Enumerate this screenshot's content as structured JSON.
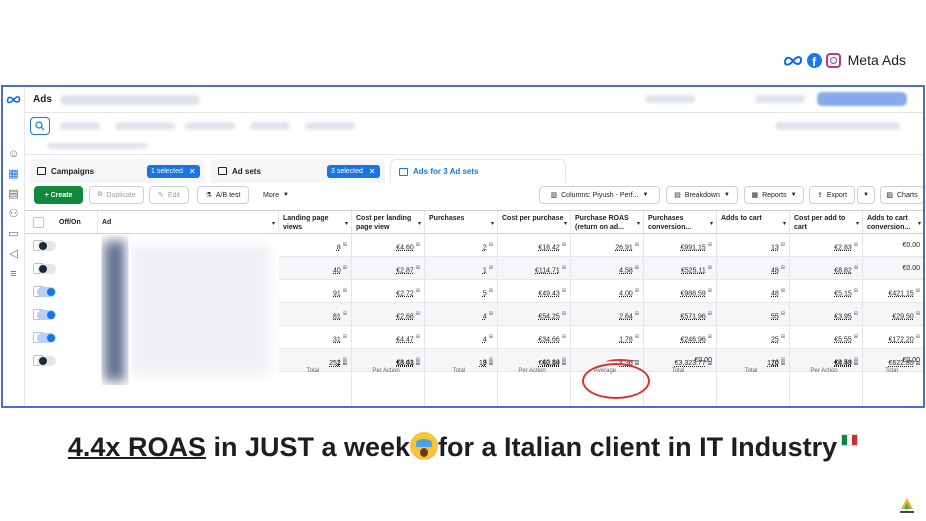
{
  "brand": {
    "text": "Meta Ads"
  },
  "app": {
    "title": "Ads"
  },
  "tabs": {
    "campaigns": {
      "label": "Campaigns",
      "pill": "1 selected"
    },
    "adsets": {
      "label": "Ad sets",
      "pill": "3 selected"
    },
    "ads": {
      "label": "Ads for 3 Ad sets"
    }
  },
  "toolbar": {
    "create": "+ Create",
    "duplicate": "Duplicate",
    "edit": "Edit",
    "ab_test": "A/B test",
    "more": "More",
    "columns": "Columns: Piyush - Perf...",
    "breakdown": "Breakdown",
    "reports": "Reports",
    "export": "Export",
    "charts": "Charts"
  },
  "table": {
    "headers": {
      "offon": "Off/On",
      "ad": "Ad",
      "c1": "Landing page views",
      "c2": "Cost per landing page view",
      "c3": "Purchases",
      "c4": "Cost per purchase",
      "c5": "Purchase ROAS (return on ad...",
      "c6": "Purchases conversion...",
      "c7": "Adds to cart",
      "c8": "Cost per add to cart",
      "c9": "Adds to cart conversion..."
    },
    "rows": [
      {
        "on": false,
        "c": [
          "8",
          "€4.60",
          "2",
          "€18.42",
          "26.91",
          "€991.15",
          "13",
          "€2.83",
          "€0.00"
        ]
      },
      {
        "on": false,
        "c": [
          "40",
          "€2.87",
          "1",
          "€114.71",
          "4.58",
          "€525.11",
          "48",
          "€8.82",
          "€0.00"
        ]
      },
      {
        "on": true,
        "c": [
          "91",
          "€2.72",
          "5",
          "€49.43",
          "4.00",
          "€988.59",
          "48",
          "€5.15",
          "€421.15"
        ]
      },
      {
        "on": true,
        "c": [
          "81",
          "€2.68",
          "4",
          "€54.25",
          "2.64",
          "€571.96",
          "55",
          "€3.95",
          "€29.50"
        ]
      },
      {
        "on": true,
        "c": [
          "31",
          "€4.47",
          "4",
          "€34.66",
          "1.78",
          "€246.96",
          "25",
          "€5.55",
          "€172.20"
        ]
      },
      {
        "on": false,
        "c": [
          "1",
          "€8.41",
          "3",
          "€2.80",
          "—",
          "€0.00",
          "16",
          "€0.53",
          "€0.00"
        ]
      }
    ],
    "totals": [
      {
        "v": "252",
        "s": "Total"
      },
      {
        "v": "€3.03",
        "s": "Per Action"
      },
      {
        "v": "19",
        "s": "Total"
      },
      {
        "v": "€40.14",
        "s": "Per Action"
      },
      {
        "v": "4.36",
        "s": "Average"
      },
      {
        "v": "€3,323.77",
        "s": "Total"
      },
      {
        "v": "170",
        "s": "Total"
      },
      {
        "v": "€4.49",
        "s": "Per Action"
      },
      {
        "v": "€622.85",
        "s": "Total"
      }
    ]
  },
  "headline": {
    "underlined": "4.4x ROAS",
    "part1": " in JUST a week",
    "part2": "for a Italian client in IT Industry"
  },
  "colors": {
    "accent": "#1b74e4",
    "frame": "#4a6bdc",
    "create": "#0f8a3c",
    "highlight": "#e0312b"
  }
}
